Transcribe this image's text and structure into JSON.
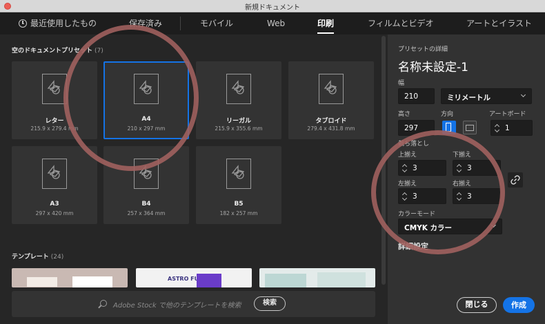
{
  "window": {
    "title": "新規ドキュメント"
  },
  "tabs": [
    {
      "label": "最近使用したもの",
      "icon": "clock-icon"
    },
    {
      "label": "保存済み"
    },
    {
      "label": "モバイル"
    },
    {
      "label": "Web"
    },
    {
      "label": "印刷",
      "active": true
    },
    {
      "label": "フィルムとビデオ"
    },
    {
      "label": "アートとイラスト"
    }
  ],
  "presets_section": {
    "title": "空のドキュメントプリセット",
    "count": "(7)"
  },
  "presets": [
    {
      "name": "レター",
      "size": "215.9 x 279.4 mm"
    },
    {
      "name": "A4",
      "size": "210 x 297 mm",
      "selected": true
    },
    {
      "name": "リーガル",
      "size": "215.9 x 355.6 mm"
    },
    {
      "name": "タブロイド",
      "size": "279.4 x 431.8 mm"
    },
    {
      "name": "A3",
      "size": "297 x 420 mm"
    },
    {
      "name": "B4",
      "size": "257 x 364 mm"
    },
    {
      "name": "B5",
      "size": "182 x 257 mm"
    }
  ],
  "templates_section": {
    "title": "テンプレート",
    "count": "(24)"
  },
  "templates": [
    {
      "thumb_label": ""
    },
    {
      "thumb_label": "ASTRO FUNK"
    },
    {
      "thumb_label": ""
    }
  ],
  "search": {
    "placeholder": "Adobe Stock で他のテンプレートを検索",
    "button": "検索"
  },
  "details": {
    "heading": "プリセットの詳細",
    "doc_name": "名称未設定-1",
    "width_label": "幅",
    "width_value": "210",
    "unit": "ミリメートル",
    "height_label": "高さ",
    "height_value": "297",
    "orientation_label": "方向",
    "artboard_label": "アートボード",
    "artboard_value": "1",
    "bleed_label": "裁ち落とし",
    "bleed_top_label": "上揃え",
    "bleed_top": "3",
    "bleed_bottom_label": "下揃え",
    "bleed_bottom": "3",
    "bleed_left_label": "左揃え",
    "bleed_left": "3",
    "bleed_right_label": "右揃え",
    "bleed_right": "3",
    "color_mode_label": "カラーモード",
    "color_mode": "CMYK カラー",
    "advanced_label": "詳細設定"
  },
  "buttons": {
    "close": "閉じる",
    "create": "作成"
  },
  "colors": {
    "accent": "#1473e6",
    "annotation": "#a0605e"
  }
}
